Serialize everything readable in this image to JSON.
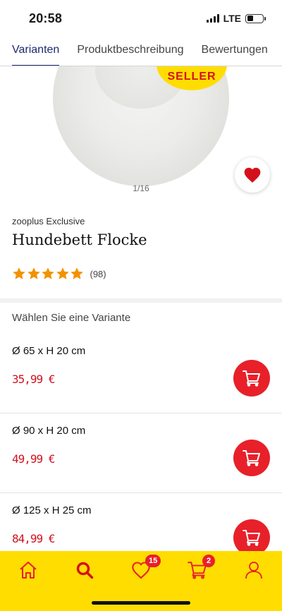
{
  "status_bar": {
    "time": "20:58",
    "network": "LTE"
  },
  "tabs": [
    {
      "label": "Varianten",
      "active": true
    },
    {
      "label": "Produktbeschreibung",
      "active": false
    },
    {
      "label": "Bewertungen",
      "active": false
    }
  ],
  "image": {
    "badge_text": "SELLER",
    "counter": "1/16"
  },
  "product": {
    "brand": "zooplus Exclusive",
    "title": "Hundebett Flocke",
    "rating": 5,
    "rating_count": "(98)"
  },
  "variants_section": {
    "title": "Wählen Sie eine Variante"
  },
  "variants": [
    {
      "size": "Ø 65 x H 20 cm",
      "price": "35,99 €"
    },
    {
      "size": "Ø 90 x H 20 cm",
      "price": "49,99 €"
    },
    {
      "size": "Ø 125 x H 25 cm",
      "price": "84,99 €"
    }
  ],
  "bottom_nav": {
    "wishlist_badge": "15",
    "cart_badge": "2"
  },
  "colors": {
    "accent_red": "#e8202a",
    "price_red": "#cf1420",
    "nav_yellow": "#ffdd00",
    "tab_active": "#1c2a6e",
    "star_orange": "#f39200"
  },
  "icons": {
    "home": "home-icon",
    "search": "search-icon",
    "wishlist": "heart-icon",
    "cart": "cart-icon",
    "account": "user-icon"
  }
}
